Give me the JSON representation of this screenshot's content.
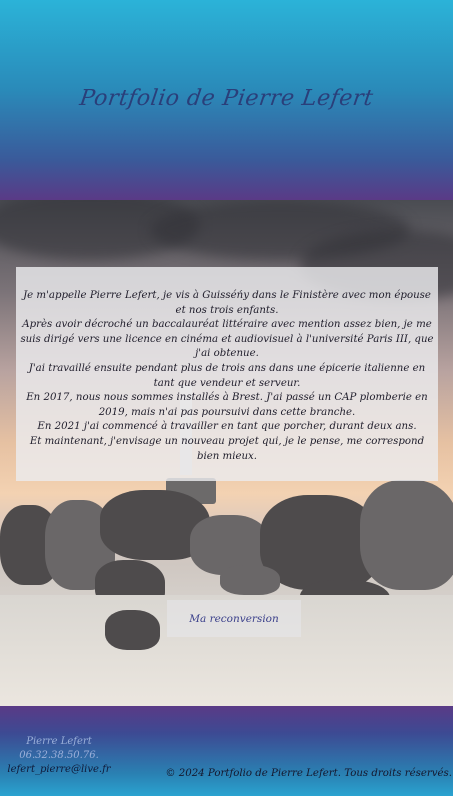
{
  "header": {
    "title": "Portfolio de Pierre Lefert"
  },
  "about": {
    "paragraphs": [
      "Je m'appelle Pierre Lefert, je vis à Guisséńy dans le Finistère avec mon épouse et nos trois enfants.",
      "Après avoir décroché un baccalauréat littéraire avec mention assez bien, je me suis dirigé vers une licence en cinéma et audiovisuel à l'université Paris III, que j'ai obtenue.",
      "J'ai travaillé ensuite pendant plus de trois ans dans une épicerie italienne en tant que vendeur et serveur.",
      "En 2017, nous nous sommes installés à Brest. J'ai passé un CAP plomberie en 2019, mais n'ai pas poursuivi dans cette branche.",
      "En 2021 j'ai commencé à travailler en tant que porcher, durant deux ans.",
      "Et maintenant, j'envisage un nouveau projet qui, je le pense, me correspond bien mieux."
    ]
  },
  "cta": {
    "label": "Ma reconversion"
  },
  "footer": {
    "contact": {
      "name": "Pierre Lefert",
      "phone": "06.32.38.50.76.",
      "email": "lefert_pierre@live.fr"
    },
    "copyright": "© 2024 Portfolio de Pierre Lefert. Tous droits réservés."
  },
  "colors": {
    "header_top": "#2bb3d8",
    "header_bottom": "#5a3a86",
    "title": "#2a3f7a",
    "link": "#3a3f8a"
  }
}
